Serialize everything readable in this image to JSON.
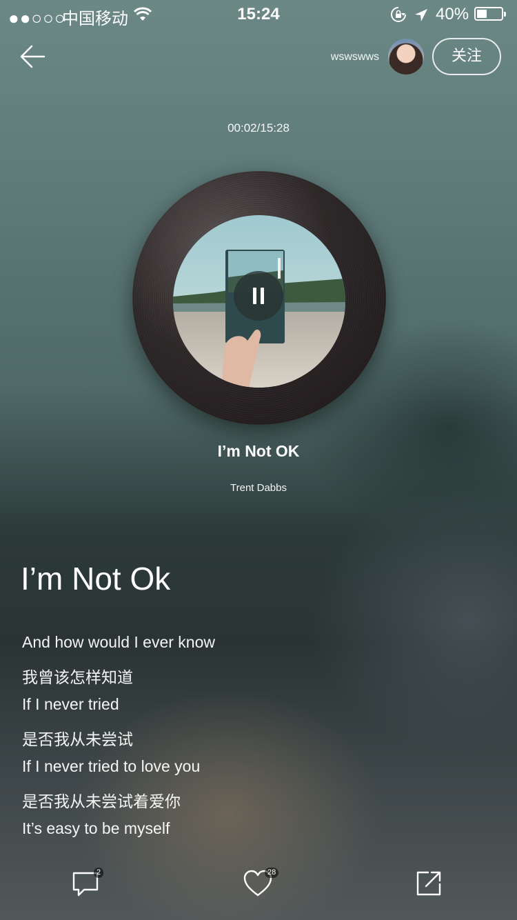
{
  "status_bar": {
    "signal": "●●○○○",
    "carrier": "中国移动",
    "time": "15:24",
    "battery_percent": "40%",
    "battery_level": 0.4,
    "icons": [
      "wifi-icon",
      "rotation-lock-icon",
      "location-arrow-icon",
      "battery-icon"
    ]
  },
  "header": {
    "back_icon": "back-arrow-icon",
    "username": "wswswws",
    "follow_label": "关注"
  },
  "player": {
    "time_display": "00:02/15:28",
    "pause_icon": "pause-icon",
    "song_title": "I’m Not OK",
    "artist": "Trent Dabbs"
  },
  "lyrics": {
    "title": "I’m Not Ok",
    "lines": [
      "And how would I ever know",
      "我曾该怎样知道",
      "If I never tried",
      "是否我从未尝试",
      "If I never tried to love you",
      "是否我从未尝试着爱你",
      "It’s easy to be myself"
    ]
  },
  "footer": {
    "comment_count": "2",
    "like_count": "28",
    "icons": [
      "comment-icon",
      "heart-icon",
      "share-icon"
    ]
  }
}
